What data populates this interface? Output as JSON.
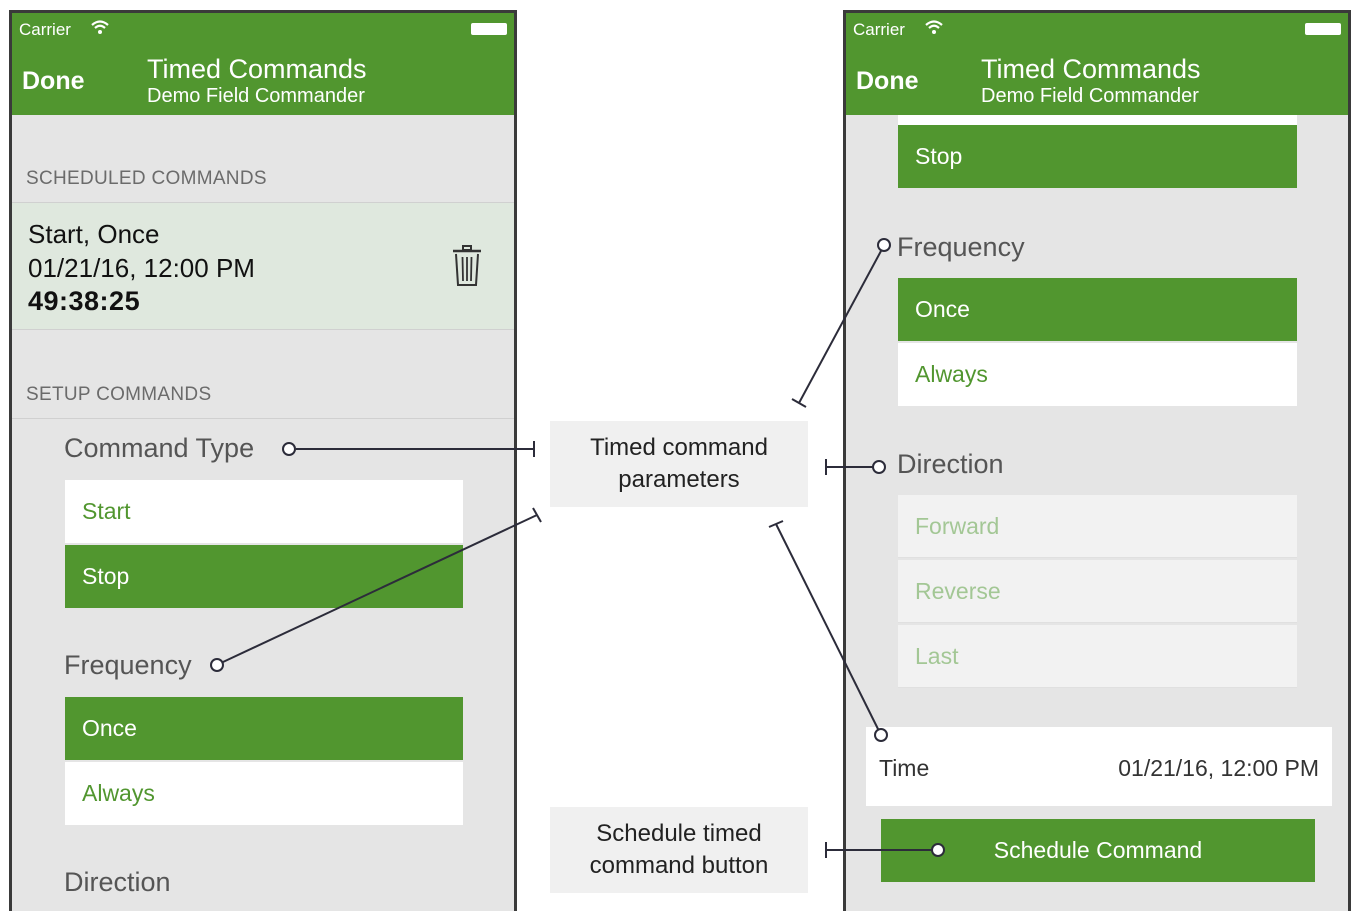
{
  "status_bar": {
    "carrier": "Carrier",
    "wifi_icon": "wifi-icon",
    "battery_icon": "battery-icon"
  },
  "nav": {
    "done_label": "Done",
    "title": "Timed Commands",
    "subtitle": "Demo Field Commander"
  },
  "left_screen": {
    "scheduled_header": "SCHEDULED COMMANDS",
    "scheduled_item": {
      "summary": "Start, Once",
      "datetime": "01/21/16, 12:00 PM",
      "countdown": "49:38:25",
      "delete_icon": "trash-icon"
    },
    "setup_header": "SETUP COMMANDS",
    "command_type_label": "Command Type",
    "command_type_options": [
      {
        "label": "Start",
        "selected": false
      },
      {
        "label": "Stop",
        "selected": true
      }
    ],
    "frequency_label": "Frequency",
    "frequency_options": [
      {
        "label": "Once",
        "selected": true
      },
      {
        "label": "Always",
        "selected": false
      }
    ],
    "direction_label": "Direction"
  },
  "right_screen": {
    "stop_option": "Stop",
    "frequency_label": "Frequency",
    "frequency_options": [
      {
        "label": "Once",
        "selected": true
      },
      {
        "label": "Always",
        "selected": false
      }
    ],
    "direction_label": "Direction",
    "direction_options": [
      {
        "label": "Forward",
        "disabled": true
      },
      {
        "label": "Reverse",
        "disabled": true
      },
      {
        "label": "Last",
        "disabled": true
      }
    ],
    "time_label": "Time",
    "time_value": "01/21/16, 12:00 PM",
    "schedule_button": "Schedule Command"
  },
  "callouts": {
    "parameters": [
      "Timed command",
      "parameters"
    ],
    "button": [
      "Schedule timed",
      "command button"
    ]
  },
  "colors": {
    "accent": "#51962f",
    "background": "#e5e5e5",
    "selected_row": "#dfe8de",
    "disabled_text": "#a3c795"
  }
}
